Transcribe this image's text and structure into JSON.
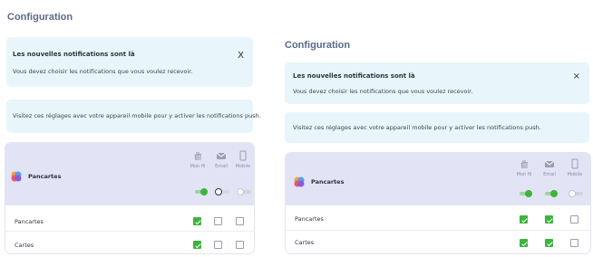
{
  "left": {
    "title": "Configuration",
    "banner": {
      "title": "Les nouvelles notifications sont là",
      "text": "Vous devez choisir les notifications que vous voulez recevoir.",
      "close": "X"
    },
    "mobile_note": "Visitez ces réglages avec votre appareil mobile pour y activer les notifications push.",
    "group": "Pancartes",
    "columns": [
      {
        "label": "Mon fil",
        "icon": "hand-wave-icon",
        "toggle": "on"
      },
      {
        "label": "Email",
        "icon": "envelope-icon",
        "toggle": "off"
      },
      {
        "label": "Mobile",
        "icon": "phone-icon",
        "toggle": "off"
      }
    ],
    "rows": [
      {
        "label": "Pancartes",
        "checks": [
          true,
          false,
          false
        ]
      },
      {
        "label": "Cartes",
        "checks": [
          true,
          false,
          false
        ]
      }
    ]
  },
  "right": {
    "title": "Configuration",
    "banner": {
      "title": "Les nouvelles notifications sont là",
      "text": "Vous devez choisir les notifications que vous voulez recevoir.",
      "close": "×"
    },
    "mobile_note": "Visitez ces réglages avec votre appareil mobile pour y activer les notifications push.",
    "group": "Pancartes",
    "columns": [
      {
        "label": "Mon fil",
        "icon": "hand-wave-icon",
        "toggle": "on"
      },
      {
        "label": "Email",
        "icon": "envelope-icon",
        "toggle": "on"
      },
      {
        "label": "Mobile",
        "icon": "phone-icon",
        "toggle": "off"
      }
    ],
    "rows": [
      {
        "label": "Pancartes",
        "checks": [
          true,
          true,
          false
        ]
      },
      {
        "label": "Cartes",
        "checks": [
          true,
          true,
          false
        ]
      }
    ]
  },
  "colors": {
    "accent_green": "#3fb33f",
    "banner_bg": "#e8f6fb",
    "header_bg": "#e3e3f6",
    "title": "#5a6a88"
  }
}
